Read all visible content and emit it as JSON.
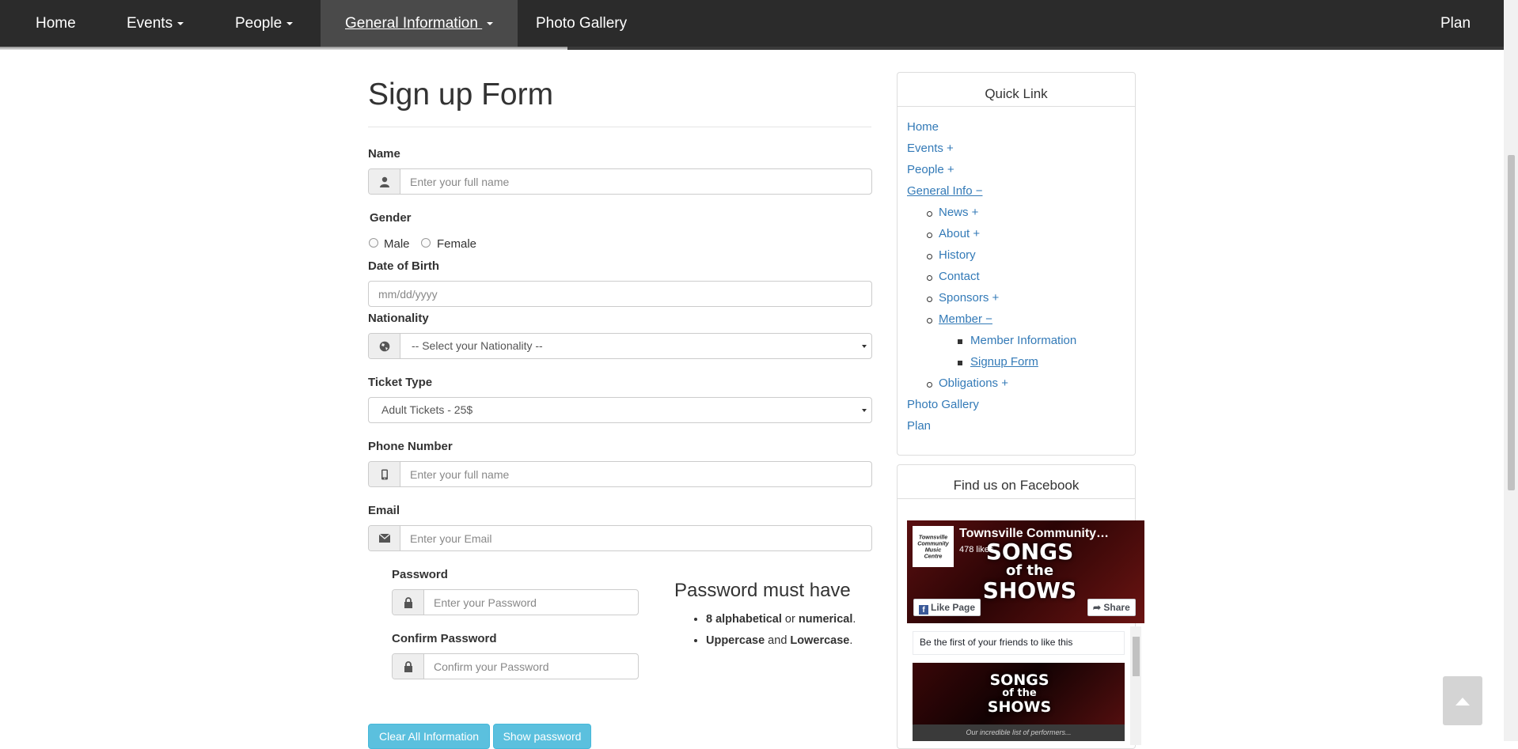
{
  "nav": {
    "items": [
      {
        "label": "Home"
      },
      {
        "label": "Events"
      },
      {
        "label": "People"
      },
      {
        "label": "General Information "
      },
      {
        "label": "Photo Gallery"
      }
    ],
    "right_label": "Plan"
  },
  "form": {
    "title": "Sign up Form",
    "name_label": "Name",
    "name_placeholder": "Enter your full name",
    "gender_label": "Gender",
    "gender_options": [
      "Male",
      "Female"
    ],
    "dob_label": "Date of Birth",
    "dob_placeholder": "mm/dd/yyyy",
    "nationality_label": "Nationality",
    "nationality_value": "-- Select your Nationality --",
    "ticket_label": "Ticket Type",
    "ticket_value": "Adult Tickets - 25$",
    "phone_label": "Phone Number",
    "phone_placeholder": "Enter your full name",
    "email_label": "Email",
    "email_placeholder": "Enter your Email",
    "password_label": "Password",
    "password_placeholder": "Enter your Password",
    "confirm_label": "Confirm Password",
    "confirm_placeholder": "Confirm your Password",
    "rules_heading": "Password must have",
    "rules": {
      "r1_bold": "8 alphabetical",
      "r1_or": " or ",
      "r1_bold2": "numerical",
      "r1_end": ".",
      "r2_bold": "Uppercase",
      "r2_and": " and ",
      "r2_bold2": "Lowercase",
      "r2_end": "."
    },
    "clear_button": "Clear All Information",
    "show_button": "Show password"
  },
  "quick_link": {
    "title": "Quick Link",
    "home": "Home",
    "events": "Events +",
    "people": "People +",
    "general": "General Info −",
    "news": "News +",
    "about": "About +",
    "history": "History",
    "contact": "Contact",
    "sponsors": "Sponsors +",
    "member": "Member −",
    "member_info": "Member Information",
    "signup": "Signup Form",
    "obligations": "Obligations +",
    "photo": "Photo Gallery",
    "plan": "Plan"
  },
  "facebook": {
    "title": "Find us on Facebook",
    "page_name": "Townsville Community…",
    "likes": "478 likes",
    "logo_text": "Townsville Community Music Centre",
    "banner_line1": "SONGS",
    "banner_line2": "of the",
    "banner_line3": "SHOWS",
    "like_button": "Like Page",
    "share_button": "Share",
    "first_friends": "Be the first of your friends to like this",
    "post_caption": "Our incredible list of performers..."
  },
  "colors": {
    "nav_bg": "#2b2b2b",
    "link": "#337ab7",
    "info_button": "#5bc0de"
  }
}
